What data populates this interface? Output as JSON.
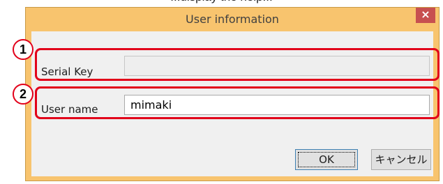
{
  "page": {
    "clipped_text": "...display the help..."
  },
  "dialog": {
    "title": "User information",
    "close_glyph": "×"
  },
  "fields": {
    "serial_key": {
      "label": "Serial Key",
      "value": "",
      "enabled": false
    },
    "user_name": {
      "label": "User name",
      "value": "mimaki"
    }
  },
  "callouts": [
    "1",
    "2"
  ],
  "buttons": {
    "ok": "OK",
    "cancel": "キャンセル"
  },
  "colors": {
    "highlight": "#e2001a",
    "window_frame": "#f8c46e",
    "close_button": "#c75050"
  }
}
